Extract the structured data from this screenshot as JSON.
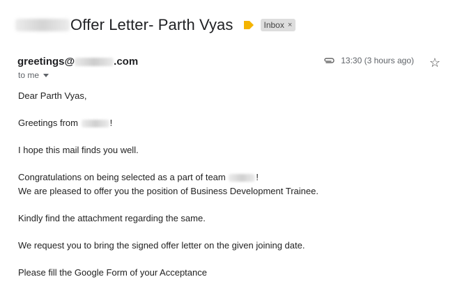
{
  "subject": {
    "prefix_redacted": "",
    "text": "Offer Letter- Parth Vyas",
    "label": "Inbox",
    "label_close": "×"
  },
  "sender": {
    "prefix": "greetings@",
    "suffix": ".com"
  },
  "recipient": {
    "text": "to me"
  },
  "meta": {
    "timestamp": "13:30 (3 hours ago)"
  },
  "body": {
    "greeting": "Dear Parth Vyas,",
    "line1_prefix": "Greetings from ",
    "line1_suffix": "!",
    "line2": "I hope this mail finds you well.",
    "line3a_prefix": "Congratulations on being selected as a part of team ",
    "line3a_suffix": "!",
    "line3b": "We are pleased to offer you the position of Business Development Trainee.",
    "line4": "Kindly find the attachment regarding the same.",
    "line5": "We request you to bring the signed offer letter on the given joining date.",
    "line6": "Please fill the Google Form of your Acceptance"
  },
  "icons": {
    "importance": "importance-marker-icon",
    "attachment": "paperclip-icon",
    "star": "star-icon",
    "dropdown": "chevron-down-icon"
  },
  "colors": {
    "importance": "#f4b400",
    "label_bg": "#dddddd",
    "text": "#222222",
    "muted": "#5f6368"
  }
}
